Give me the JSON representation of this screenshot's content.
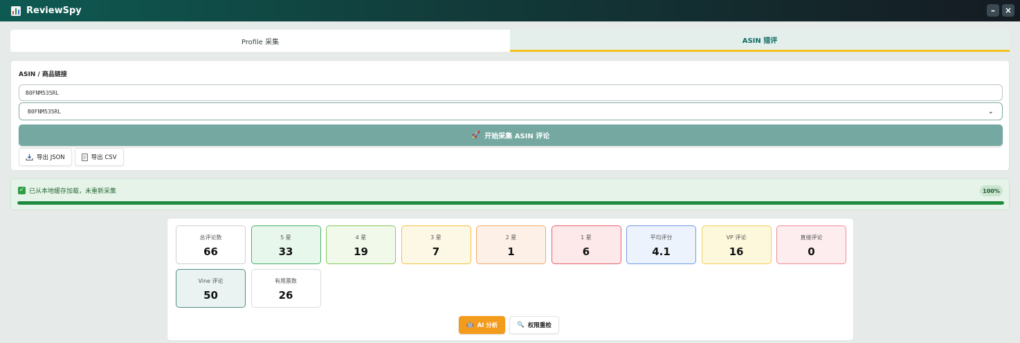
{
  "app": {
    "title": "ReviewSpy",
    "minimize_label": "–",
    "close_label": "×"
  },
  "tabs": [
    {
      "label": "Profile 采集",
      "active": false
    },
    {
      "label": "ASIN 猎评",
      "active": true
    }
  ],
  "form": {
    "field_label": "ASIN / 商品链接",
    "asin_input_value": "B0FNM535RL",
    "asin_select_value": "B0FNM535RL",
    "start_icon": "🚀",
    "start_label": "开始采集 ASIN 评论",
    "export_json_label": "导出 JSON",
    "export_csv_label": "导出 CSV"
  },
  "status": {
    "message": "已从本地缓存加载，未重新采集",
    "percent_label": "100%",
    "progress": 1.0,
    "accent": "#1f8a3e"
  },
  "stats": [
    {
      "label": "总评论数",
      "value": "66",
      "border": "#cfcfcf",
      "bg": "#ffffff"
    },
    {
      "label": "5 星",
      "value": "33",
      "border": "#49b06a",
      "bg": "#e8f7ec"
    },
    {
      "label": "4 星",
      "value": "19",
      "border": "#86c95a",
      "bg": "#f0f9ea"
    },
    {
      "label": "3 星",
      "value": "7",
      "border": "#f0c040",
      "bg": "#fdf8e6"
    },
    {
      "label": "2 星",
      "value": "1",
      "border": "#f2a96a",
      "bg": "#fdf0e6"
    },
    {
      "label": "1 星",
      "value": "6",
      "border": "#e8606a",
      "bg": "#fde8ea"
    },
    {
      "label": "平均评分",
      "value": "4.1",
      "border": "#6f9be6",
      "bg": "#edf3fd"
    },
    {
      "label": "VP 评论",
      "value": "16",
      "border": "#f0d15c",
      "bg": "#fdf7dc"
    },
    {
      "label": "直接评论",
      "value": "0",
      "border": "#ef8a95",
      "bg": "#fdedef"
    },
    {
      "label": "Vine 评论",
      "value": "50",
      "border": "#4f8f86",
      "bg": "#eaf3f1"
    },
    {
      "label": "有用票数",
      "value": "26",
      "border": "#d9dcdc",
      "bg": "#ffffff"
    }
  ],
  "actions": {
    "ai_icon": "🤖",
    "ai_label": "AI 分析",
    "recheck_icon": "🔍",
    "recheck_label": "权限重检"
  }
}
